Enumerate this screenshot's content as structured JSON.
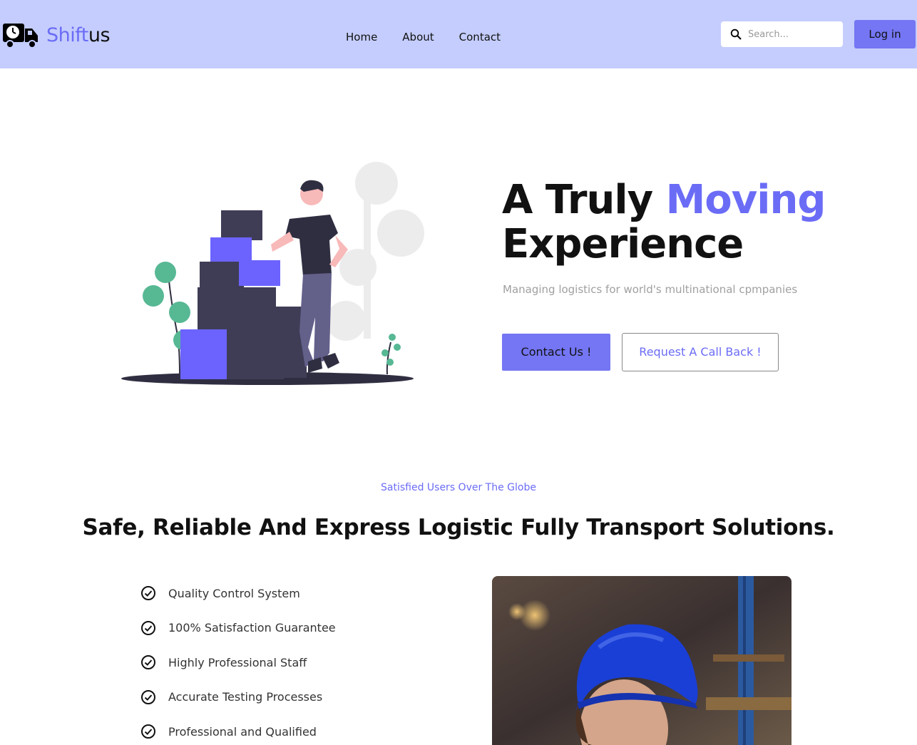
{
  "header": {
    "logo_text_part1": "Shift",
    "logo_text_part2": "us",
    "logo_icon": "truck-clock-icon",
    "nav": [
      {
        "label": "Home"
      },
      {
        "label": "About"
      },
      {
        "label": "Contact"
      }
    ],
    "search": {
      "placeholder": "Search...",
      "value": "",
      "icon": "search-icon"
    },
    "login_label": "Log in"
  },
  "hero": {
    "title_part1": "A Truly ",
    "title_accent": "Moving",
    "title_part2": "Experience",
    "subtitle": "Managing logistics for world's multinational cpmpanies",
    "primary_button": "Contact Us !",
    "secondary_button": "Request A Call Back !"
  },
  "features": {
    "eyebrow": "Satisfied Users Over The Globe",
    "title": "Safe, Reliable And Express Logistic Fully Transport Solutions.",
    "items": [
      {
        "label": "Quality Control System",
        "icon": "check-circle-icon"
      },
      {
        "label": "100% Satisfaction Guarantee",
        "icon": "check-circle-icon"
      },
      {
        "label": "Highly Professional Staff",
        "icon": "check-circle-icon"
      },
      {
        "label": "Accurate Testing Processes",
        "icon": "check-circle-icon"
      },
      {
        "label": "Professional and Qualified",
        "icon": "check-circle-icon"
      }
    ]
  },
  "colors": {
    "header_bg": "#c4cdfd",
    "accent": "#6b6cf6",
    "button": "#7476f4"
  }
}
